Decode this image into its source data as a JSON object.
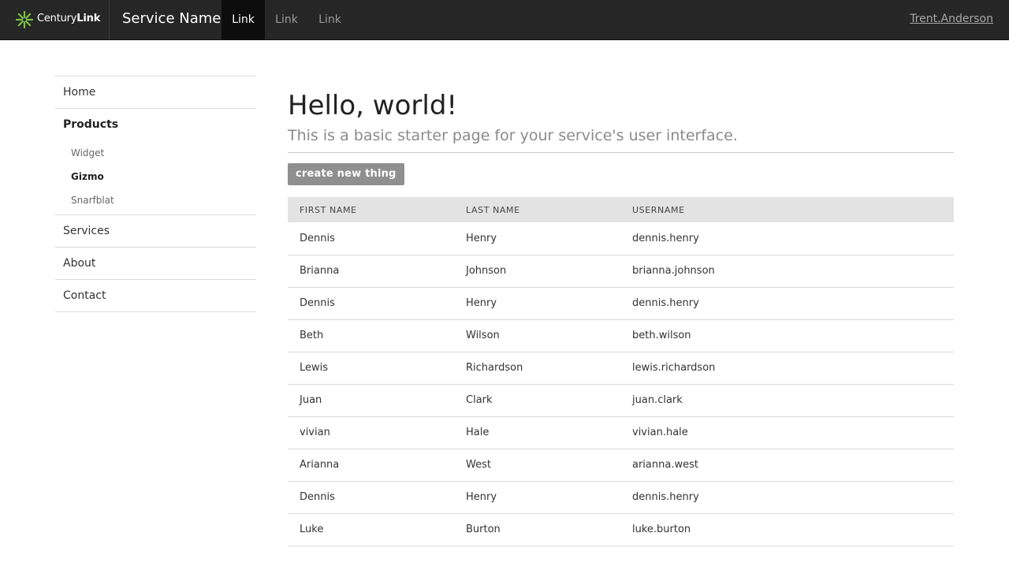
{
  "navbar": {
    "brand": {
      "name_light": "Century",
      "name_bold": "Link"
    },
    "service_name": "Service Name",
    "links": [
      {
        "label": "Link",
        "active": true
      },
      {
        "label": "Link",
        "active": false
      },
      {
        "label": "Link",
        "active": false
      }
    ],
    "user": "Trent.Anderson"
  },
  "sidebar": {
    "home": "Home",
    "products": "Products",
    "product_items": [
      "Widget",
      "Gizmo",
      "Snarfblat"
    ],
    "active_product": "Gizmo",
    "services": "Services",
    "about": "About",
    "contact": "Contact"
  },
  "main": {
    "title": "Hello, world!",
    "subtitle": "This is a basic starter page for your service's user interface.",
    "button_label": "create new thing",
    "table": {
      "headers": [
        "FIRST NAME",
        "LAST NAME",
        "USERNAME"
      ],
      "rows": [
        [
          "Dennis",
          "Henry",
          "dennis.henry"
        ],
        [
          "Brianna",
          "Johnson",
          "brianna.johnson"
        ],
        [
          "Dennis",
          "Henry",
          "dennis.henry"
        ],
        [
          "Beth",
          "Wilson",
          "beth.wilson"
        ],
        [
          "Lewis",
          "Richardson",
          "lewis.richardson"
        ],
        [
          "Juan",
          "Clark",
          "juan.clark"
        ],
        [
          "vivian",
          "Hale",
          "vivian.hale"
        ],
        [
          "Arianna",
          "West",
          "arianna.west"
        ],
        [
          "Dennis",
          "Henry",
          "dennis.henry"
        ],
        [
          "Luke",
          "Burton",
          "luke.burton"
        ]
      ]
    }
  },
  "colors": {
    "navbar_bg": "#262626",
    "logo_green": "#7bc143",
    "button_bg": "#8f8f8f",
    "table_header_bg": "#e3e3e3"
  }
}
